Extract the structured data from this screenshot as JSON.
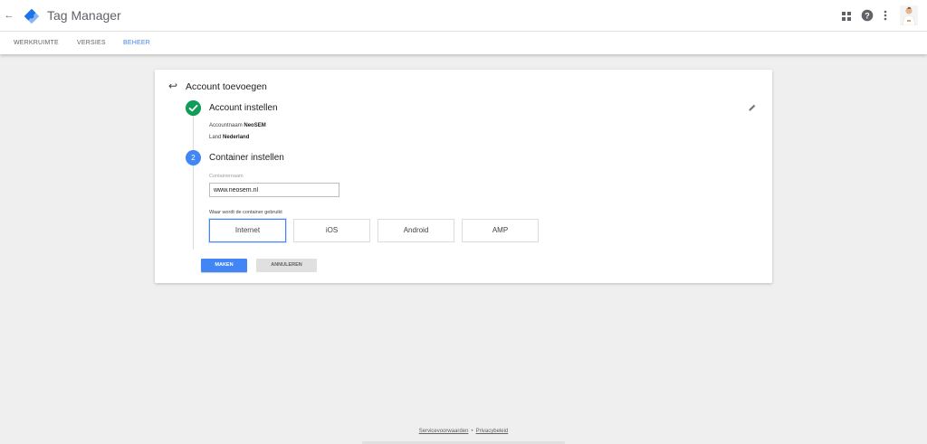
{
  "app": {
    "title": "Tag Manager",
    "brand_colors": {
      "dark": "#1a73e8",
      "light": "#8ab4f8",
      "accent": "#4285f4"
    },
    "icons": [
      "back-arrow-icon",
      "tag-manager-logo-icon",
      "apps-icon",
      "help-icon",
      "more-vert-icon",
      "avatar"
    ]
  },
  "nav": {
    "tabs": [
      {
        "label": "WERKRUIMTE",
        "active": false
      },
      {
        "label": "VERSIES",
        "active": false
      },
      {
        "label": "BEHEER",
        "active": true
      }
    ]
  },
  "card": {
    "title": "Account toevoegen",
    "step1": {
      "title": "Account instellen",
      "status": "complete",
      "account_label": "Accountnaam",
      "account_value": "NeoSEM",
      "country_label": "Land",
      "country_value": "Nederland"
    },
    "step2": {
      "number": "2",
      "title": "Container instellen",
      "container_label": "Containernaam",
      "container_value": "www.neosem.nl",
      "platform_question": "Waar wordt de container gebruikt",
      "platforms": [
        {
          "label": "Internet",
          "selected": true
        },
        {
          "label": "iOS",
          "selected": false
        },
        {
          "label": "Android",
          "selected": false
        },
        {
          "label": "AMP",
          "selected": false
        }
      ]
    },
    "actions": {
      "create": "MAKEN",
      "cancel": "ANNULEREN"
    }
  },
  "footer": {
    "terms": "Servicevoorwaarden",
    "separator": "•",
    "privacy": "Privacybeleid"
  }
}
